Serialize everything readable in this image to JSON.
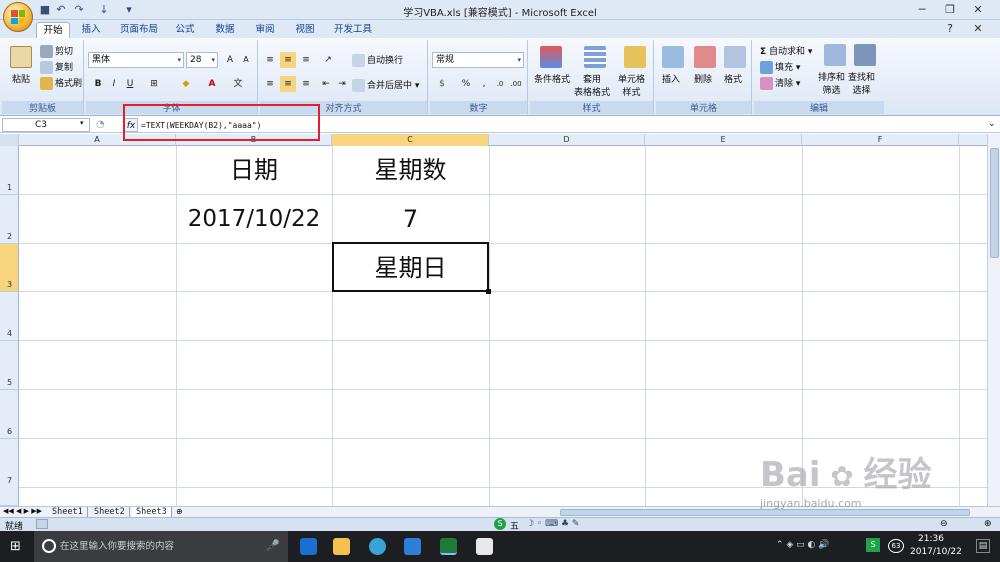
{
  "window": {
    "title": "学习VBA.xls  [兼容模式] - Microsoft Excel",
    "minimize_icon": "minimize-icon",
    "maximize_icon": "restore-icon",
    "close_icon": "close-icon"
  },
  "tabs": [
    "开始",
    "插入",
    "页面布局",
    "公式",
    "数据",
    "审阅",
    "视图",
    "开发工具"
  ],
  "ribbon": {
    "clipboard": {
      "label": "剪贴板",
      "paste": "粘贴",
      "cut": "剪切",
      "copy": "复制",
      "format_painter": "格式刷"
    },
    "font": {
      "label": "字体",
      "font_name": "黑体",
      "font_size": "28",
      "bold": "B",
      "italic": "I",
      "underline": "U"
    },
    "alignment": {
      "label": "对齐方式",
      "wrap": "自动换行",
      "merge": "合并后居中"
    },
    "number": {
      "label": "数字",
      "format": "常规",
      "percent": "%",
      "comma": ","
    },
    "styles": {
      "label": "样式",
      "conditional": "条件格式",
      "table_format": "套用\n表格格式",
      "cell_style": "单元格\n样式"
    },
    "cells": {
      "label": "单元格",
      "insert": "插入",
      "delete": "删除",
      "format": "格式"
    },
    "editing": {
      "label": "编辑",
      "autosum": "自动求和",
      "fill": "填充",
      "clear": "清除",
      "sort": "排序和\n筛选",
      "find": "查找和\n选择"
    }
  },
  "formula_bar": {
    "name_box": "C3",
    "fx": "fx",
    "formula": "=TEXT(WEEKDAY(B2),\"aaaa\")"
  },
  "columns": [
    "A",
    "B",
    "C",
    "D",
    "E",
    "F"
  ],
  "rows": [
    "1",
    "2",
    "3",
    "4",
    "5",
    "6",
    "7"
  ],
  "cells": {
    "B1": "日期",
    "C1": "星期数",
    "B2": "2017/10/22",
    "C2": "7",
    "C3": "星期日"
  },
  "sheets": [
    "Sheet1",
    "Sheet2",
    "Sheet3"
  ],
  "status": {
    "mode": "就绪",
    "ime_label": "五"
  },
  "taskbar": {
    "search_placeholder": "在这里输入你要搜索的内容",
    "time": "21:36",
    "date": "2017/10/22",
    "badge": "63"
  },
  "watermark": {
    "line1": "Bai",
    "line2": "经验",
    "url": "jingyan.baidu.com"
  },
  "colors": {
    "selection": "#f8d47e",
    "highlight": "#e0202a",
    "ribbon": "#dce7f5"
  }
}
